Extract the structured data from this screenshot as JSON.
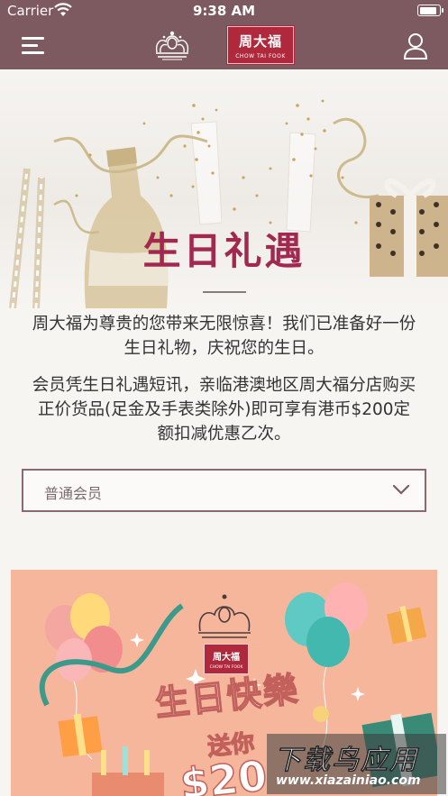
{
  "status_bar": {
    "carrier": "Carrier",
    "time": "9:38 AM",
    "battery_level": 0.9
  },
  "nav": {
    "menu_icon": "hamburger-menu-icon",
    "crown_logo_icon": "crown-icon",
    "brand_logo_cn": "周大福",
    "brand_logo_en": "CHOW TAI FOOK",
    "user_icon": "user-profile-icon",
    "bar_color": "#7d5a5f"
  },
  "hero": {
    "title": "生日礼遇",
    "title_color": "#a1284f"
  },
  "intro": {
    "line1": "周大福为尊贵的您带来无限惊喜！我们已准备好一份",
    "line2": "生日礼物，庆祝您的生日。"
  },
  "detail": {
    "line1": "会员凭生日礼遇短讯，亲临港澳地区周大福分店购买",
    "line2": "正价货品(足金及手表类除外)即可享有港币$200定",
    "line3": "额扣减优惠乙次。"
  },
  "tier_select": {
    "value": "普通会员",
    "icon": "chevron-down-icon"
  },
  "promo": {
    "brand_cn": "周大福",
    "brand_en": "CHOW TAI FOOK",
    "title": "生日快樂",
    "subtitle": "送你",
    "amount": "$20",
    "background_color": "#f6b69c"
  },
  "watermark": {
    "title": "下载鸟应用",
    "url": "www.xiazainiao.com"
  }
}
